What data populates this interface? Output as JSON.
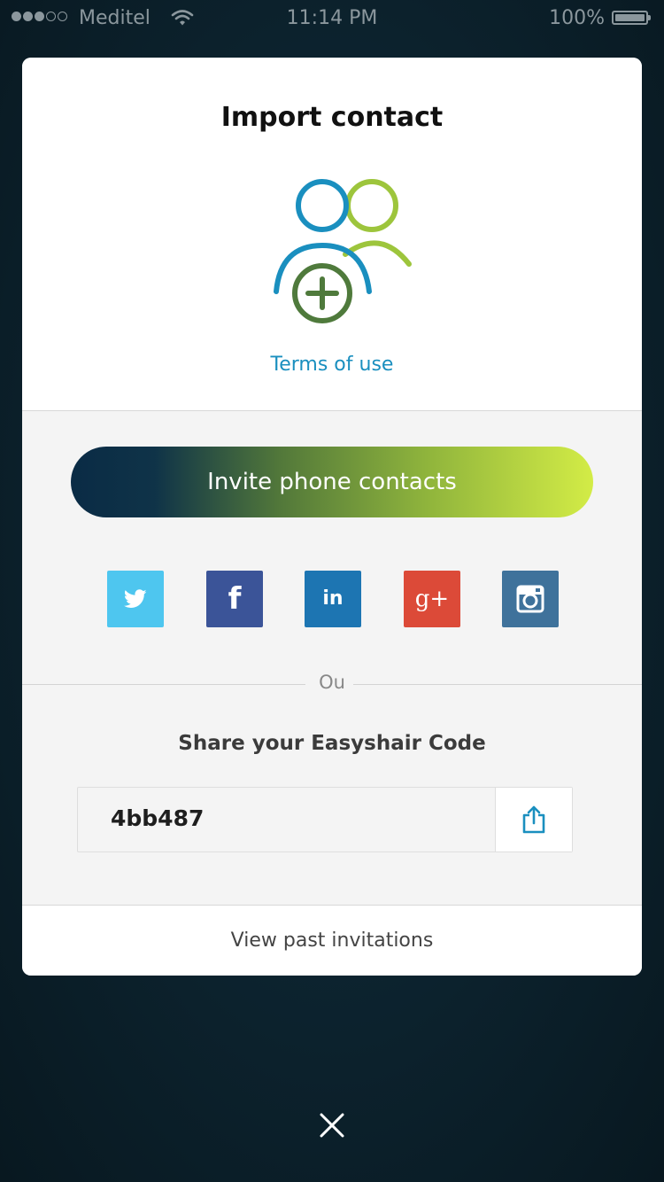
{
  "status_bar": {
    "carrier": "Meditel",
    "time": "11:14 PM",
    "battery": "100%",
    "signal_bars_filled": 3,
    "signal_bars_total": 5
  },
  "modal": {
    "title": "Import contact",
    "terms_link": "Terms of use",
    "invite_button": "Invite phone contacts",
    "social": [
      {
        "name": "twitter",
        "glyph": "",
        "color": "#4ec6ef"
      },
      {
        "name": "facebook",
        "glyph": "f",
        "color": "#3b5498"
      },
      {
        "name": "linkedin",
        "glyph": "in",
        "color": "#1d75b2"
      },
      {
        "name": "google-plus",
        "glyph": "g+",
        "color": "#dc4a38"
      },
      {
        "name": "instagram",
        "glyph": "",
        "color": "#3f729b"
      }
    ],
    "divider_text": "Ou",
    "share_heading": "Share your Easyshair Code",
    "code": "4bb487",
    "view_past": "View past invitations"
  },
  "colors": {
    "accent_blue": "#1a8fbf",
    "accent_green": "#9dc53c",
    "accent_dark_green": "#4f7a3c"
  }
}
